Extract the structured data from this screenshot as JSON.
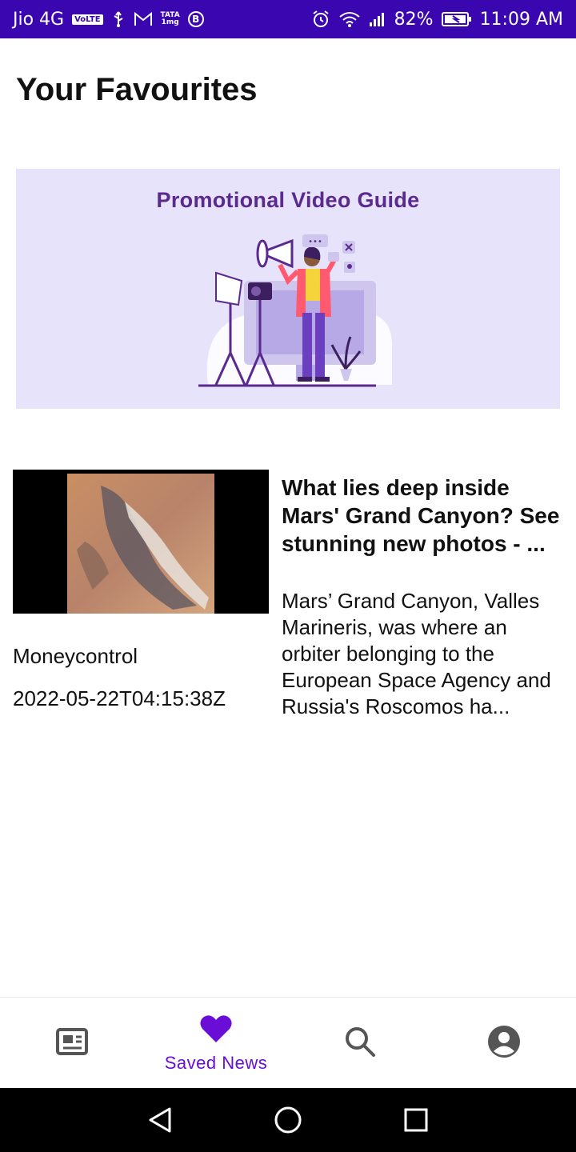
{
  "status_bar": {
    "carrier": "Jio 4G",
    "volte": "VoLTE",
    "tata_top": "TATA",
    "tata_bottom": "1mg",
    "b_badge": "B",
    "signal_label": "",
    "battery": "82%",
    "time": "11:09 AM",
    "icons": [
      "usb-icon",
      "gmail-icon",
      "alarm-icon",
      "wifi-icon",
      "signal-icon",
      "battery-charging-icon"
    ]
  },
  "page": {
    "title": "Your Favourites"
  },
  "banner": {
    "title": "Promotional Video Guide"
  },
  "article": {
    "title": "What lies deep inside Mars' Grand Canyon? See stunning new photos - ...",
    "description": "Mars’ Grand Canyon, Valles Marineris, was where an orbiter belonging to the European Space Agency and Russia's Roscomos ha...",
    "source": "Moneycontrol",
    "published_at": "2022-05-22T04:15:38Z"
  },
  "bottom_nav": {
    "items": [
      {
        "icon": "newspaper-icon",
        "label": "",
        "active": false
      },
      {
        "icon": "heart-icon",
        "label": "Saved News",
        "active": true
      },
      {
        "icon": "search-icon",
        "label": "",
        "active": false
      },
      {
        "icon": "account-icon",
        "label": "",
        "active": false
      }
    ],
    "accent_color": "#6a0dd6"
  },
  "colors": {
    "status_bar": "#3a06b0",
    "banner_bg": "#e7e3fb",
    "banner_title": "#5b2a8f"
  }
}
